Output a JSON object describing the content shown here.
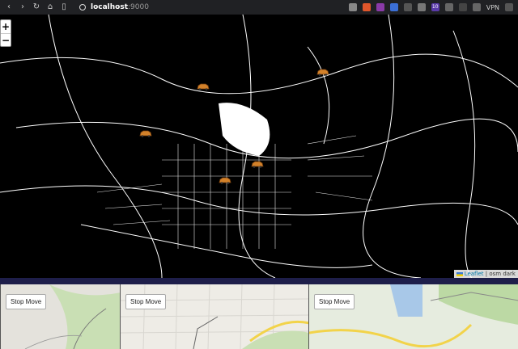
{
  "browser": {
    "url_host": "localhost",
    "url_port": ":9000",
    "vpn_label": "VPN",
    "badge_count": "10"
  },
  "map": {
    "zoom_in": "+",
    "zoom_out": "−",
    "attribution_link": "Leaflet",
    "attribution_text": "| osm dark"
  },
  "thumbnails": [
    {
      "button": "Stop Move"
    },
    {
      "button": "Stop Move"
    },
    {
      "button": "Stop Move"
    }
  ]
}
